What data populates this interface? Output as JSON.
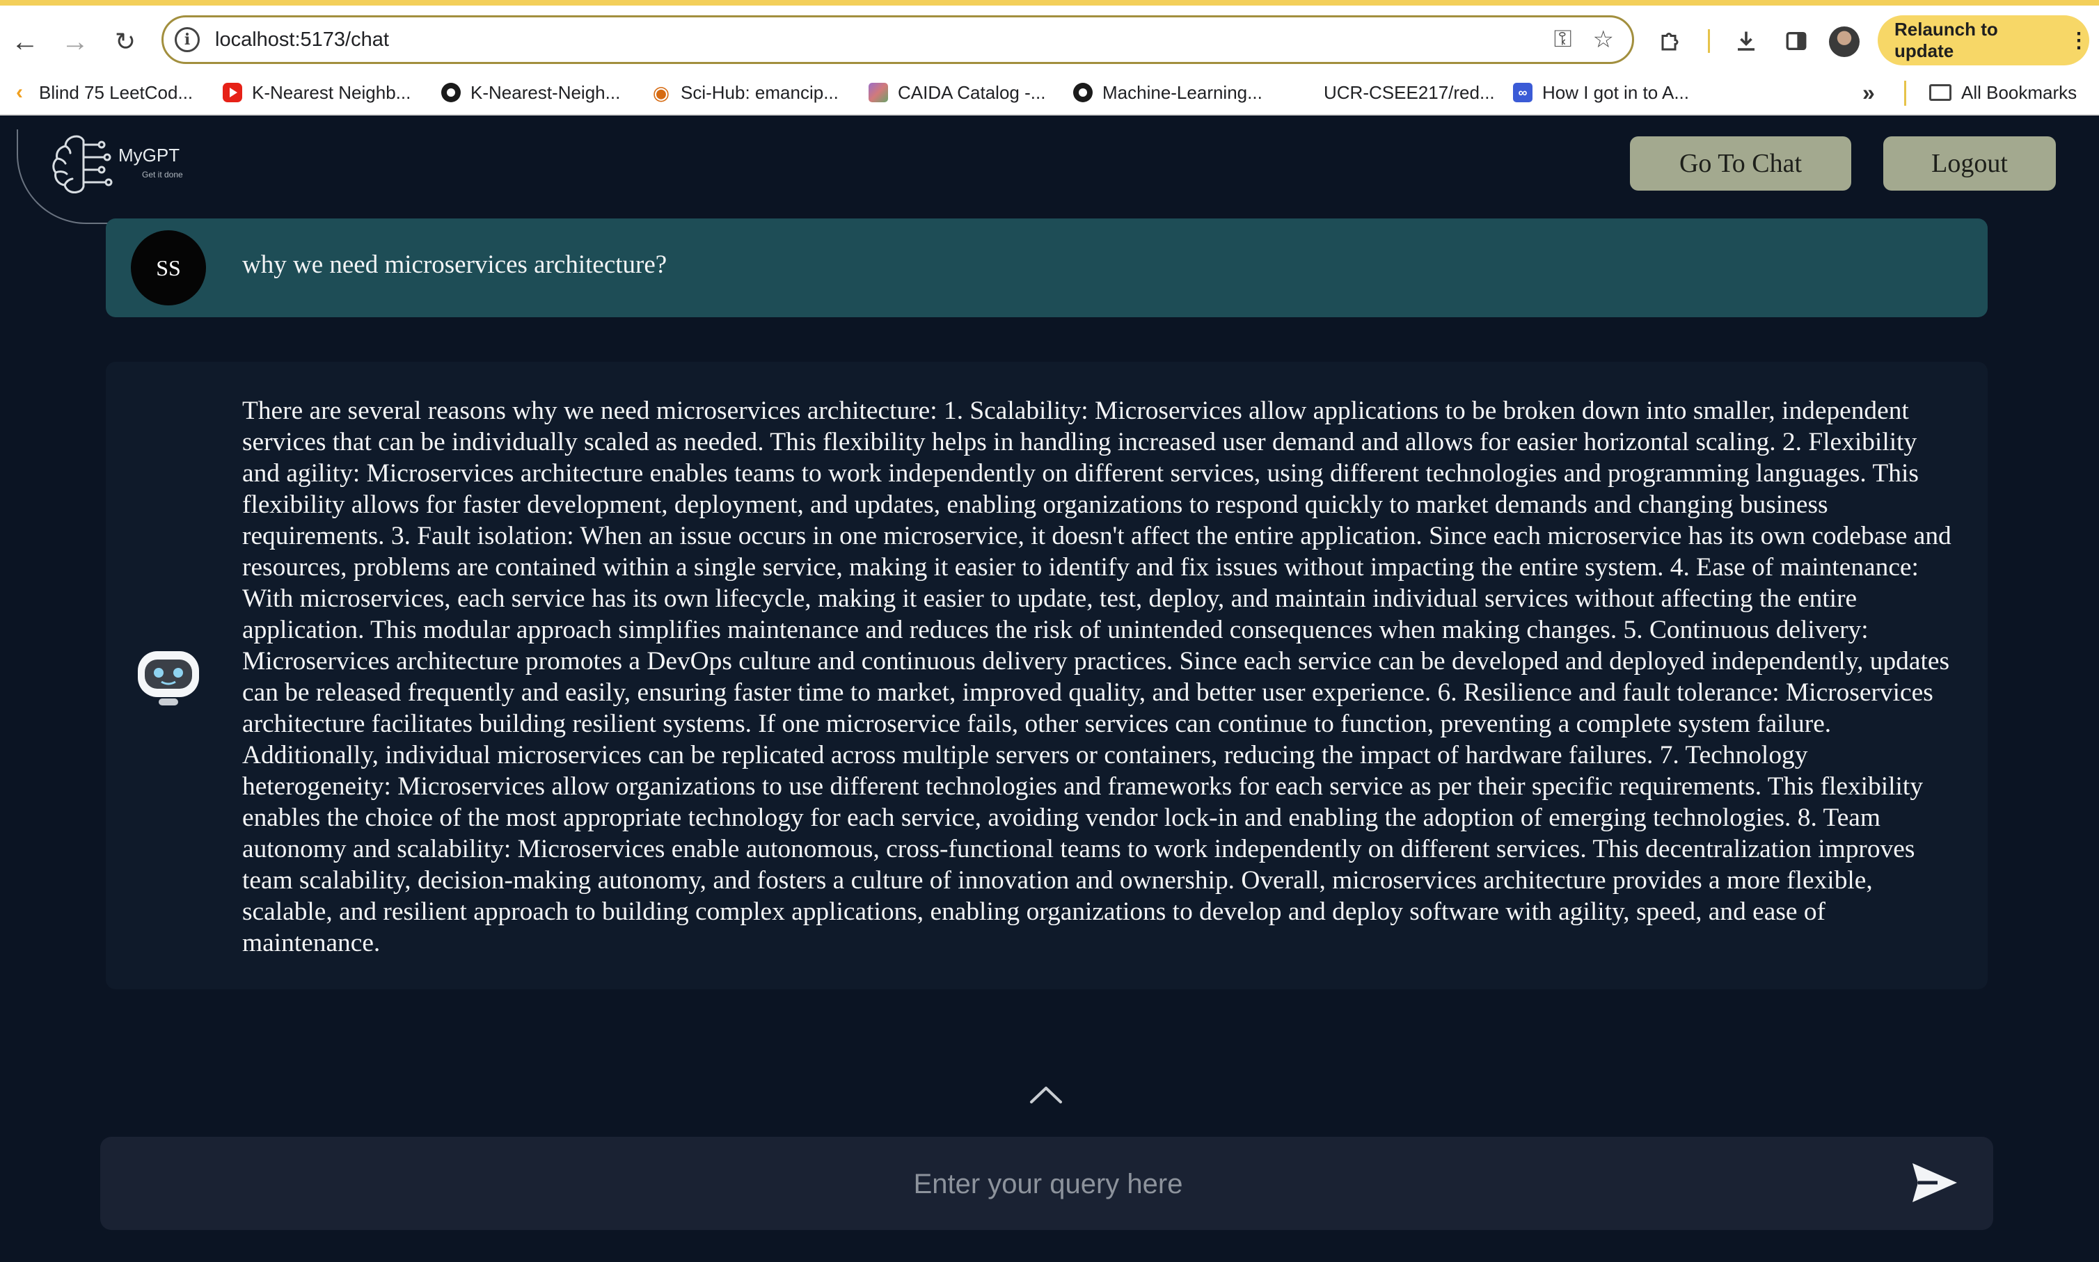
{
  "browser": {
    "url": "localhost:5173/chat",
    "relaunch_label": "Relaunch to update",
    "bookmarks": [
      {
        "label": "Blind 75 LeetCod...",
        "icon": "leetcode-icon"
      },
      {
        "label": "K-Nearest Neighb...",
        "icon": "youtube-icon"
      },
      {
        "label": "K-Nearest-Neigh...",
        "icon": "github-icon"
      },
      {
        "label": "Sci-Hub: emancip...",
        "icon": "scihub-icon"
      },
      {
        "label": "CAIDA Catalog -...",
        "icon": "caida-icon"
      },
      {
        "label": "Machine-Learning...",
        "icon": "github-icon"
      },
      {
        "label": "UCR-CSEE217/red...",
        "icon": "none"
      },
      {
        "label": "How I got in to A...",
        "icon": "infinity-icon"
      }
    ],
    "more_label": "»",
    "all_bookmarks_label": "All Bookmarks"
  },
  "header": {
    "logo_title": "MyGPT",
    "logo_subtitle": "Get it done",
    "go_to_chat_label": "Go To Chat",
    "logout_label": "Logout"
  },
  "chat": {
    "user_initials": "SS",
    "user_message": "why we need microservices architecture?",
    "bot_message": "There are several reasons why we need microservices architecture: 1. Scalability: Microservices allow applications to be broken down into smaller, independent services that can be individually scaled as needed. This flexibility helps in handling increased user demand and allows for easier horizontal scaling. 2. Flexibility and agility: Microservices architecture enables teams to work independently on different services, using different technologies and programming languages. This flexibility allows for faster development, deployment, and updates, enabling organizations to respond quickly to market demands and changing business requirements. 3. Fault isolation: When an issue occurs in one microservice, it doesn't affect the entire application. Since each microservice has its own codebase and resources, problems are contained within a single service, making it easier to identify and fix issues without impacting the entire system. 4. Ease of maintenance: With microservices, each service has its own lifecycle, making it easier to update, test, deploy, and maintain individual services without affecting the entire application. This modular approach simplifies maintenance and reduces the risk of unintended consequences when making changes. 5. Continuous delivery: Microservices architecture promotes a DevOps culture and continuous delivery practices. Since each service can be developed and deployed independently, updates can be released frequently and easily, ensuring faster time to market, improved quality, and better user experience. 6. Resilience and fault tolerance: Microservices architecture facilitates building resilient systems. If one microservice fails, other services can continue to function, preventing a complete system failure. Additionally, individual microservices can be replicated across multiple servers or containers, reducing the impact of hardware failures. 7. Technology heterogeneity: Microservices allow organizations to use different technologies and frameworks for each service as per their specific requirements. This flexibility enables the choice of the most appropriate technology for each service, avoiding vendor lock-in and enabling the adoption of emerging technologies. 8. Team autonomy and scalability: Microservices enable autonomous, cross-functional teams to work independently on different services. This decentralization improves team scalability, decision-making autonomy, and fosters a culture of innovation and ownership. Overall, microservices architecture provides a more flexible, scalable, and resilient approach to building complex applications, enabling organizations to develop and deploy software with agility, speed, and ease of maintenance."
  },
  "composer": {
    "placeholder": "Enter your query here",
    "value": ""
  },
  "colors": {
    "page_background": "#0b1423",
    "user_card": "#1e4d56",
    "bot_card": "#0f1a2a",
    "header_buttons": "#a3a98f",
    "input_bar": "#1a2233"
  }
}
